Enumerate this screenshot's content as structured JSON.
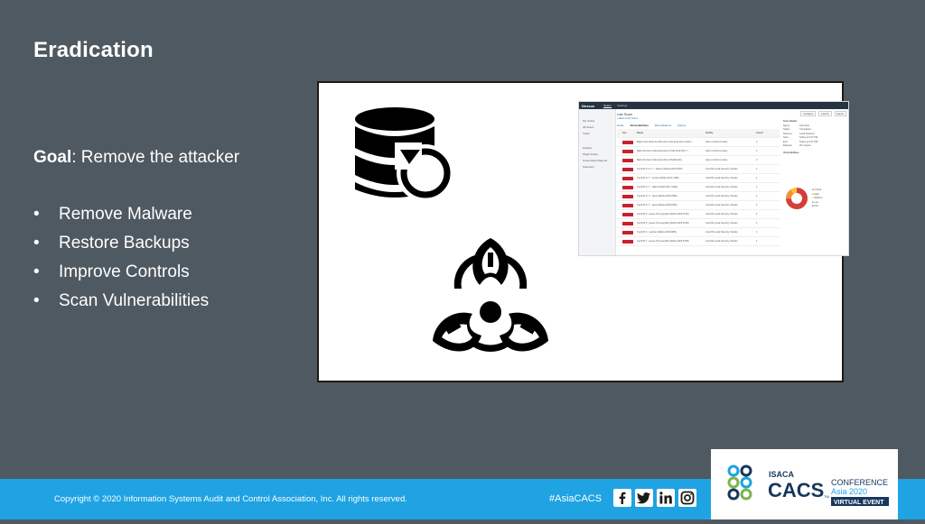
{
  "slide": {
    "title": "Eradication",
    "goal_label": "Goal",
    "goal_text": ": Remove the attacker",
    "bullet_symbol": "•",
    "bullets": [
      "Remove Malware",
      "Restore Backups",
      "Improve Controls",
      "Scan Vulnerabilities"
    ]
  },
  "icons": {
    "database_restore": "database-restore-icon",
    "biohazard": "biohazard-icon"
  },
  "nessus": {
    "logo": "Nessus",
    "nav": [
      "Scans",
      "Settings"
    ],
    "scan_title": "Lab Scan",
    "back_link": "« Back to My Scans",
    "sidebar": [
      "My Scans",
      "All Scans",
      "Trash",
      "Policies",
      "Plugin Rules",
      "Customized Reports",
      "Scanners"
    ],
    "tabs": [
      "Hosts",
      "Vulnerabilities",
      "Remediations",
      "History"
    ],
    "buttons": [
      "Configure",
      "Launch",
      "Export"
    ],
    "columns": [
      "Sev",
      "Name",
      "Family",
      "Count"
    ],
    "rows": [
      {
        "sev": "CRITICAL",
        "name": "Bash Incomplete Fix Remote Code Execution Vulner...",
        "family": "Gain a shell remotely",
        "count": "2"
      },
      {
        "sev": "CRITICAL",
        "name": "Bash Remote Code Execution (CVE-2014-6277 / ...",
        "family": "Gain a shell remotely",
        "count": "2"
      },
      {
        "sev": "CRITICAL",
        "name": "Bash Remote Code Execution (Shellshock)",
        "family": "Gain a shell remotely",
        "count": "2"
      },
      {
        "sev": "CRITICAL",
        "name": "CentOS 5 / 6 / 7 : firefox (CESA-2015:0976)",
        "family": "CentOS Local Security Checks",
        "count": "1"
      },
      {
        "sev": "CRITICAL",
        "name": "CentOS 6 / 7 : kernel (CESA-2017:1382)",
        "family": "CentOS Local Security Checks",
        "count": "1"
      },
      {
        "sev": "CRITICAL",
        "name": "CentOS 6 / 7 : flash (CESA-2017:1461)",
        "family": "CentOS Local Security Checks",
        "count": "1"
      },
      {
        "sev": "CRITICAL",
        "name": "CentOS 6 / 7 : java (CESA-2015:1586)",
        "family": "CentOS Local Security Checks",
        "count": "1"
      },
      {
        "sev": "CRITICAL",
        "name": "CentOS 6 / 7 : java (CESA-2015:1550)",
        "family": "CentOS Local Security Checks",
        "count": "1"
      },
      {
        "sev": "CRITICAL",
        "name": "CentOS 6 : java-1.8.0-openjdk (CESA-2015:0715)",
        "family": "CentOS Local Security Checks",
        "count": "1"
      },
      {
        "sev": "CRITICAL",
        "name": "CentOS 6 : java-1.8.0-openjdk (CESA-2015:1518)",
        "family": "CentOS Local Security Checks",
        "count": "1"
      },
      {
        "sev": "CRITICAL",
        "name": "CentOS 6 : samba (CESA-2015:0256)",
        "family": "CentOS Local Security Checks",
        "count": "1"
      },
      {
        "sev": "CRITICAL",
        "name": "CentOS 7 : java-1.8.0-openjdk (CESA-2015:0708)",
        "family": "CentOS Local Security Checks",
        "count": "1"
      }
    ],
    "details_title": "Scan Details",
    "details": [
      {
        "k": "Name",
        "v": "Lab Scan"
      },
      {
        "k": "Status",
        "v": "Completed"
      },
      {
        "k": "Scanner",
        "v": "Local Scanner"
      },
      {
        "k": "Start",
        "v": "Today at 9:07 PM"
      },
      {
        "k": "End",
        "v": "Today at 9:27 PM"
      },
      {
        "k": "Elapsed",
        "v": "20 minutes"
      }
    ],
    "vuln_title": "Vulnerabilities",
    "legend": [
      "Critical",
      "High",
      "Medium",
      "Low",
      "Info"
    ],
    "donut_colors": [
      "#d43f3a",
      "#ee9336",
      "#fdc431",
      "#3fae49",
      "#0071b9"
    ]
  },
  "footer": {
    "copyright": "Copyright © 2020 Information Systems Audit and Control Association, Inc. All rights reserved.",
    "hashtag": "#AsiaCACS",
    "social": [
      "facebook-icon",
      "twitter-icon",
      "linkedin-icon",
      "instagram-icon"
    ]
  },
  "logo": {
    "isaca": "ISACA",
    "cacs": "CACS",
    "tm": "TM",
    "conference": "CONFERENCE",
    "asia": "Asia 2020",
    "virtual": "VIRTUAL EVENT",
    "accent": "#1fa3e2",
    "navy": "#17365d",
    "green": "#7ab648"
  }
}
